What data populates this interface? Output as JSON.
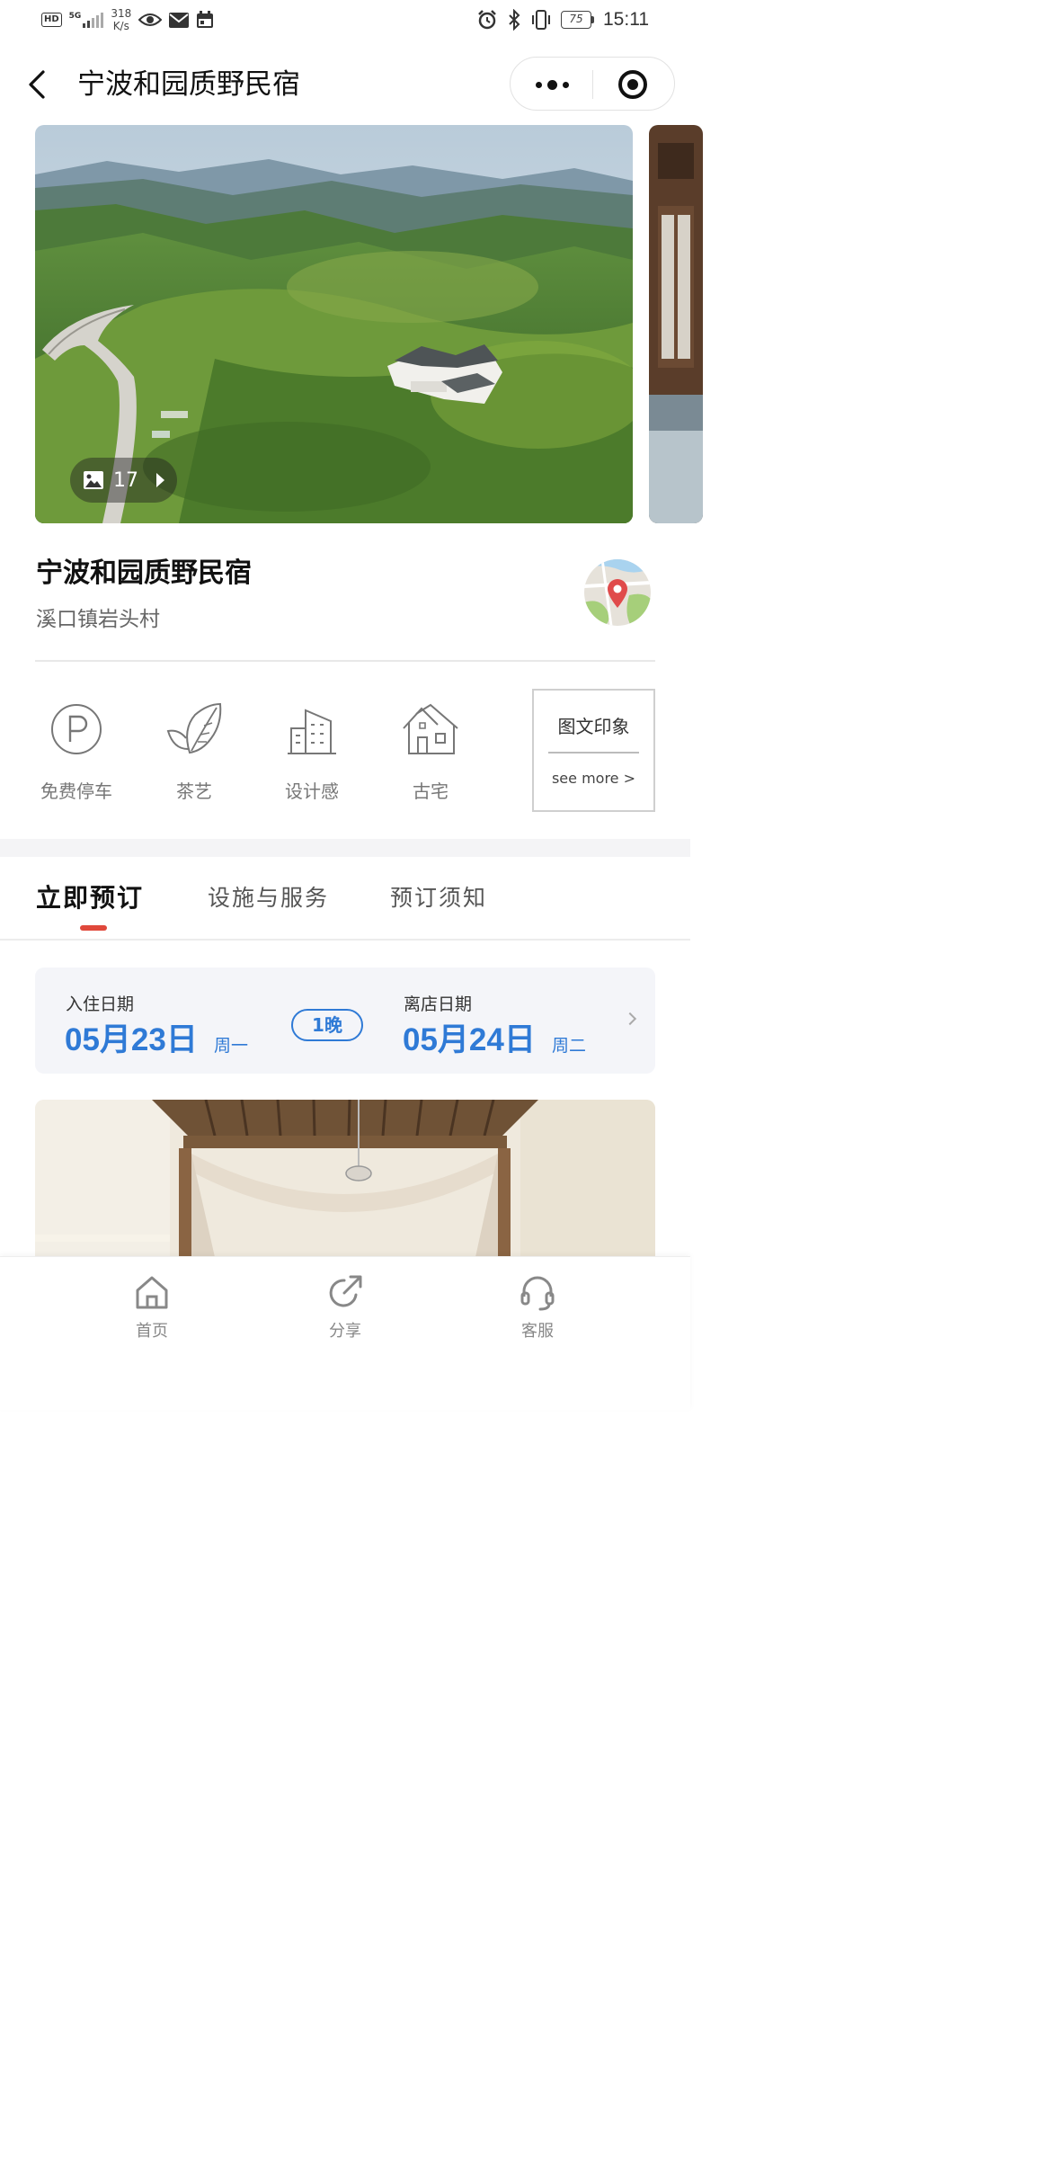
{
  "status_bar": {
    "hd": "HD",
    "network": "5G",
    "speed_value": "318",
    "speed_unit": "K/s",
    "battery": "75",
    "time": "15:11"
  },
  "nav": {
    "title": "宁波和园质野民宿"
  },
  "gallery": {
    "photo_count": "17"
  },
  "hotel": {
    "name": "宁波和园质野民宿",
    "address": "溪口镇岩头村"
  },
  "features": [
    {
      "label": "免费停车",
      "icon": "parking-icon"
    },
    {
      "label": "茶艺",
      "icon": "tea-leaf-icon"
    },
    {
      "label": "设计感",
      "icon": "building-icon"
    },
    {
      "label": "古宅",
      "icon": "old-house-icon"
    }
  ],
  "more_card": {
    "title": "图文印象",
    "link": "see more >"
  },
  "tabs": [
    {
      "label": "立即预订",
      "active": true
    },
    {
      "label": "设施与服务",
      "active": false
    },
    {
      "label": "预订须知",
      "active": false
    }
  ],
  "booking": {
    "checkin_label": "入住日期",
    "checkin_date": "05月23日",
    "checkin_weekday": "周一",
    "nights": "1晚",
    "checkout_label": "离店日期",
    "checkout_date": "05月24日",
    "checkout_weekday": "周二"
  },
  "bottom_nav": [
    {
      "label": "首页",
      "icon": "home-icon"
    },
    {
      "label": "分享",
      "icon": "share-icon"
    },
    {
      "label": "客服",
      "icon": "headset-icon"
    }
  ],
  "colors": {
    "accent_blue": "#2f7ad6",
    "tab_indicator": "#e0483b"
  }
}
